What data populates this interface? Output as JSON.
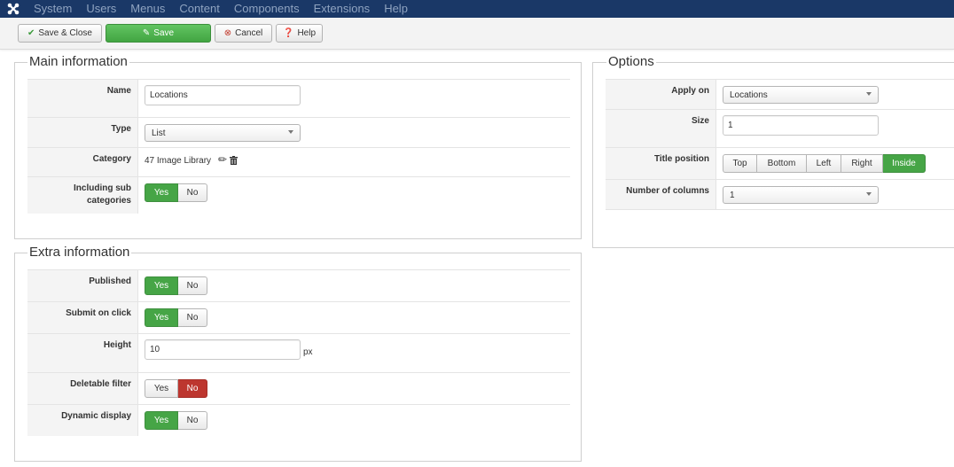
{
  "navbar": {
    "logo_icon": "joomla-logo-icon",
    "items": [
      "System",
      "Users",
      "Menus",
      "Content",
      "Components",
      "Extensions",
      "Help"
    ]
  },
  "toolbar": {
    "save_close": "Save & Close",
    "save": "Save",
    "cancel": "Cancel",
    "help": "Help"
  },
  "main_info": {
    "legend": "Main information",
    "name_label": "Name",
    "name_value": "Locations",
    "type_label": "Type",
    "type_value": "List",
    "category_label": "Category",
    "category_value": "47 Image Library",
    "subcat_label": "Including sub categories",
    "subcat_yes": "Yes",
    "subcat_no": "No",
    "subcat_selected": "Yes"
  },
  "extra_info": {
    "legend": "Extra information",
    "published_label": "Published",
    "published_selected": "Yes",
    "submit_label": "Submit on click",
    "submit_selected": "Yes",
    "height_label": "Height",
    "height_value": "10",
    "height_unit": "px",
    "deletable_label": "Deletable filter",
    "deletable_selected": "No",
    "dynamic_label": "Dynamic display",
    "dynamic_selected": "Yes",
    "yes": "Yes",
    "no": "No"
  },
  "options": {
    "legend": "Options",
    "apply_label": "Apply on",
    "apply_value": "Locations",
    "size_label": "Size",
    "size_value": "1",
    "title_pos_label": "Title position",
    "title_pos_options": [
      "Top",
      "Bottom",
      "Left",
      "Right",
      "Inside"
    ],
    "title_pos_selected": "Inside",
    "columns_label": "Number of columns",
    "columns_value": "1"
  },
  "colors": {
    "navbar": "#1a3867",
    "green": "#46a546",
    "red": "#bd362f"
  }
}
